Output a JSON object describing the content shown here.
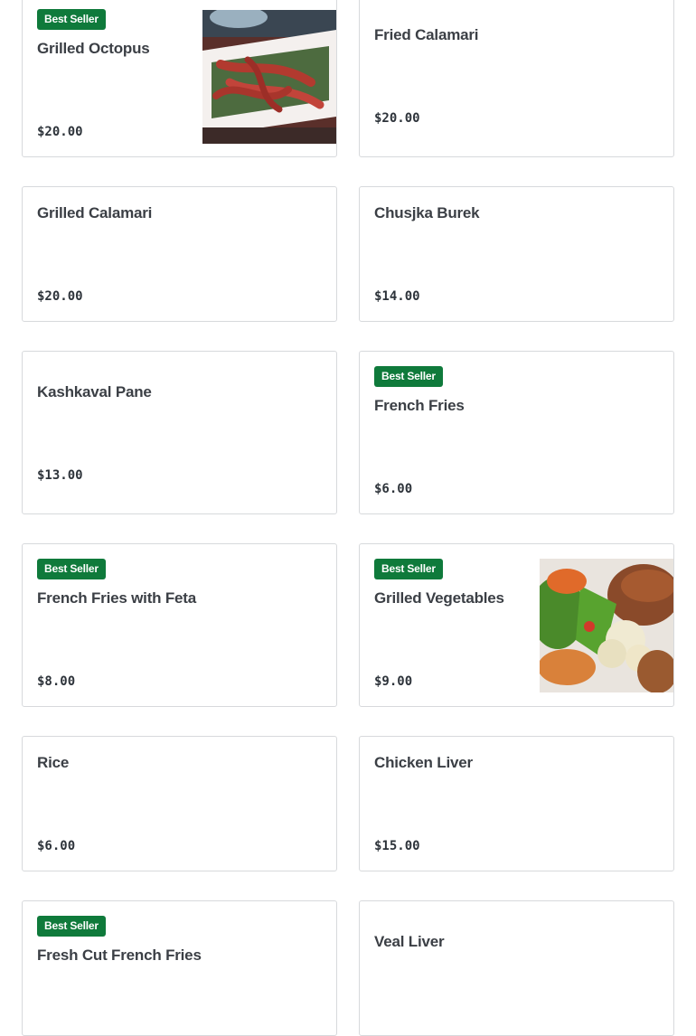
{
  "menu_items": [
    {
      "name": "Grilled Octopus",
      "price": "$20.00",
      "badge": "Best Seller",
      "image": "grilled-octopus-photo"
    },
    {
      "name": "Fried Calamari",
      "price": "$20.00"
    },
    {
      "name": "Grilled Calamari",
      "price": "$20.00"
    },
    {
      "name": "Chusjka Burek",
      "price": "$14.00"
    },
    {
      "name": "Kashkaval Pane",
      "price": "$13.00"
    },
    {
      "name": "French Fries",
      "price": "$6.00",
      "badge": "Best Seller"
    },
    {
      "name": "French Fries with Feta",
      "price": "$8.00",
      "badge": "Best Seller"
    },
    {
      "name": "Grilled Vegetables",
      "price": "$9.00",
      "badge": "Best Seller",
      "image": "grilled-vegetables-photo"
    },
    {
      "name": "Rice",
      "price": "$6.00"
    },
    {
      "name": "Chicken Liver",
      "price": "$15.00"
    },
    {
      "name": "Fresh Cut French Fries",
      "badge": "Best Seller"
    },
    {
      "name": "Veal Liver"
    }
  ],
  "colors": {
    "badge": "#0f7a3b",
    "border": "#d7d9dc",
    "text": "#2d333a"
  }
}
